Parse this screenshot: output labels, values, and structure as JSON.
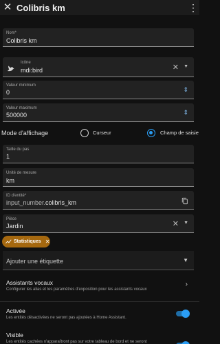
{
  "header": {
    "title": "Colibris km",
    "close_icon": "close-icon",
    "menu_icon": "more-vertical-icon"
  },
  "name_field": {
    "label": "Nom*",
    "value": "Colibris km"
  },
  "icon_field": {
    "label": "Icône",
    "value": "mdi:bird"
  },
  "min_field": {
    "label": "Valeur minimum",
    "value": "0"
  },
  "max_field": {
    "label": "Valeur maximum",
    "value": "500000"
  },
  "display_mode": {
    "label": "Mode d'affichage",
    "options": [
      "Curseur",
      "Champ de saisie"
    ],
    "selected": "Champ de saisie"
  },
  "step_field": {
    "label": "Taille du pas",
    "value": "1"
  },
  "unit_field": {
    "label": "Unité de mesure",
    "value": "km"
  },
  "entity_field": {
    "label": "ID d'entité*",
    "prefix": "input_number.",
    "value": "colibris_km"
  },
  "area_field": {
    "label": "Pièce",
    "value": "Jardin"
  },
  "label_chip": {
    "text": "Statistiques"
  },
  "add_label": {
    "text": "Ajouter une étiquette"
  },
  "voice": {
    "title": "Assistants vocaux",
    "desc": "Configurer les alias et les paramètres d'exposition pour les assistants vocaux"
  },
  "enabled": {
    "title": "Activée",
    "desc": "Les entités désactivées ne seront pas ajoutées à Home Assistant.",
    "on": true
  },
  "visible": {
    "title": "Visible",
    "desc": "Les entités cachées n'apparaîtront pas sur votre tableau de bord et ne seront"
  },
  "colors": {
    "accent": "#2a9df4",
    "chip": "#a5680f"
  }
}
